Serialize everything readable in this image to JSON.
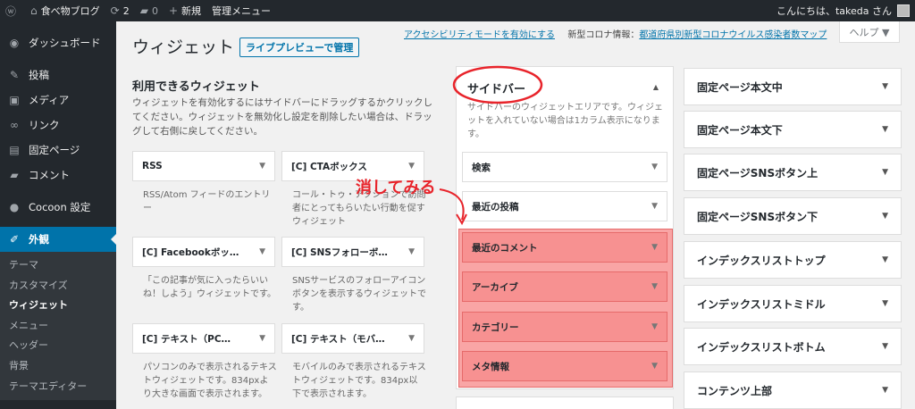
{
  "adminbar": {
    "site_name": "食べ物ブログ",
    "updates_count": "2",
    "comments_count": "0",
    "new_label": "新規",
    "manage_menu": "管理メニュー",
    "greeting": "こんにちは、takeda さん"
  },
  "menu": {
    "dashboard": "ダッシュボード",
    "posts": "投稿",
    "media": "メディア",
    "links": "リンク",
    "pages": "固定ページ",
    "comments": "コメント",
    "cocoon": "Cocoon 設定",
    "appearance": "外観",
    "sub": [
      "テーマ",
      "カスタマイズ",
      "ウィジェット",
      "メニュー",
      "ヘッダー",
      "背景",
      "テーマエディター"
    ]
  },
  "header": {
    "title": "ウィジェット",
    "live_preview": "ライブプレビューで管理",
    "accessibility_link": "アクセシビリティモードを有効にする",
    "notice_prefix": "新型コロナ情報：",
    "notice_link": "都道府県別新型コロナウイルス感染者数マップ",
    "help": "ヘルプ ▼"
  },
  "available": {
    "title": "利用できるウィジェット",
    "desc": "ウィジェットを有効化するにはサイドバーにドラッグするかクリックしてください。ウィジェットを無効化し設定を削除したい場合は、ドラッグして右側に戻してください。",
    "widgets": [
      {
        "label": "RSS",
        "desc": "RSS/Atom フィードのエントリー"
      },
      {
        "label": "[C] CTAボックス",
        "desc": "コール・トゥ・アクションで訪問者にとってもらいたい行動を促すウィジェット"
      },
      {
        "label": "[C] Facebookボッ…",
        "desc": "「この記事が気に入ったらいいね！しよう」ウィジェットです。"
      },
      {
        "label": "[C] SNSフォローボ…",
        "desc": "SNSサービスのフォローアイコンボタンを表示するウィジェットです。"
      },
      {
        "label": "[C] テキスト（PC…",
        "desc": "パソコンのみで表示されるテキストウィジェットです。834pxより大きな画面で表示されます。"
      },
      {
        "label": "[C] テキスト（モバ…",
        "desc": "モバイルのみで表示されるテキストウィジェットです。834px以下で表示されます。"
      }
    ]
  },
  "sidebar_area": {
    "title": "サイドバー",
    "desc": "サイドバーのウィジェットエリアです。ウィジェットを入れていない場合は1カラム表示になります。",
    "widgets": [
      "検索",
      "最近の投稿",
      "最近のコメント",
      "アーカイブ",
      "カテゴリー",
      "メタ情報"
    ]
  },
  "right_areas": [
    "固定ページ本文中",
    "固定ページ本文下",
    "固定ページSNSボタン上",
    "固定ページSNSボタン下",
    "インデックスリストトップ",
    "インデックスリストミドル",
    "インデックスリストボトム",
    "コンテンツ上部"
  ],
  "annotation": {
    "text": "消してみる",
    "color": "#e8242b"
  },
  "colors": {
    "adminbar": "#23282d",
    "active_menu": "#0073aa",
    "highlight": "#f79191"
  }
}
